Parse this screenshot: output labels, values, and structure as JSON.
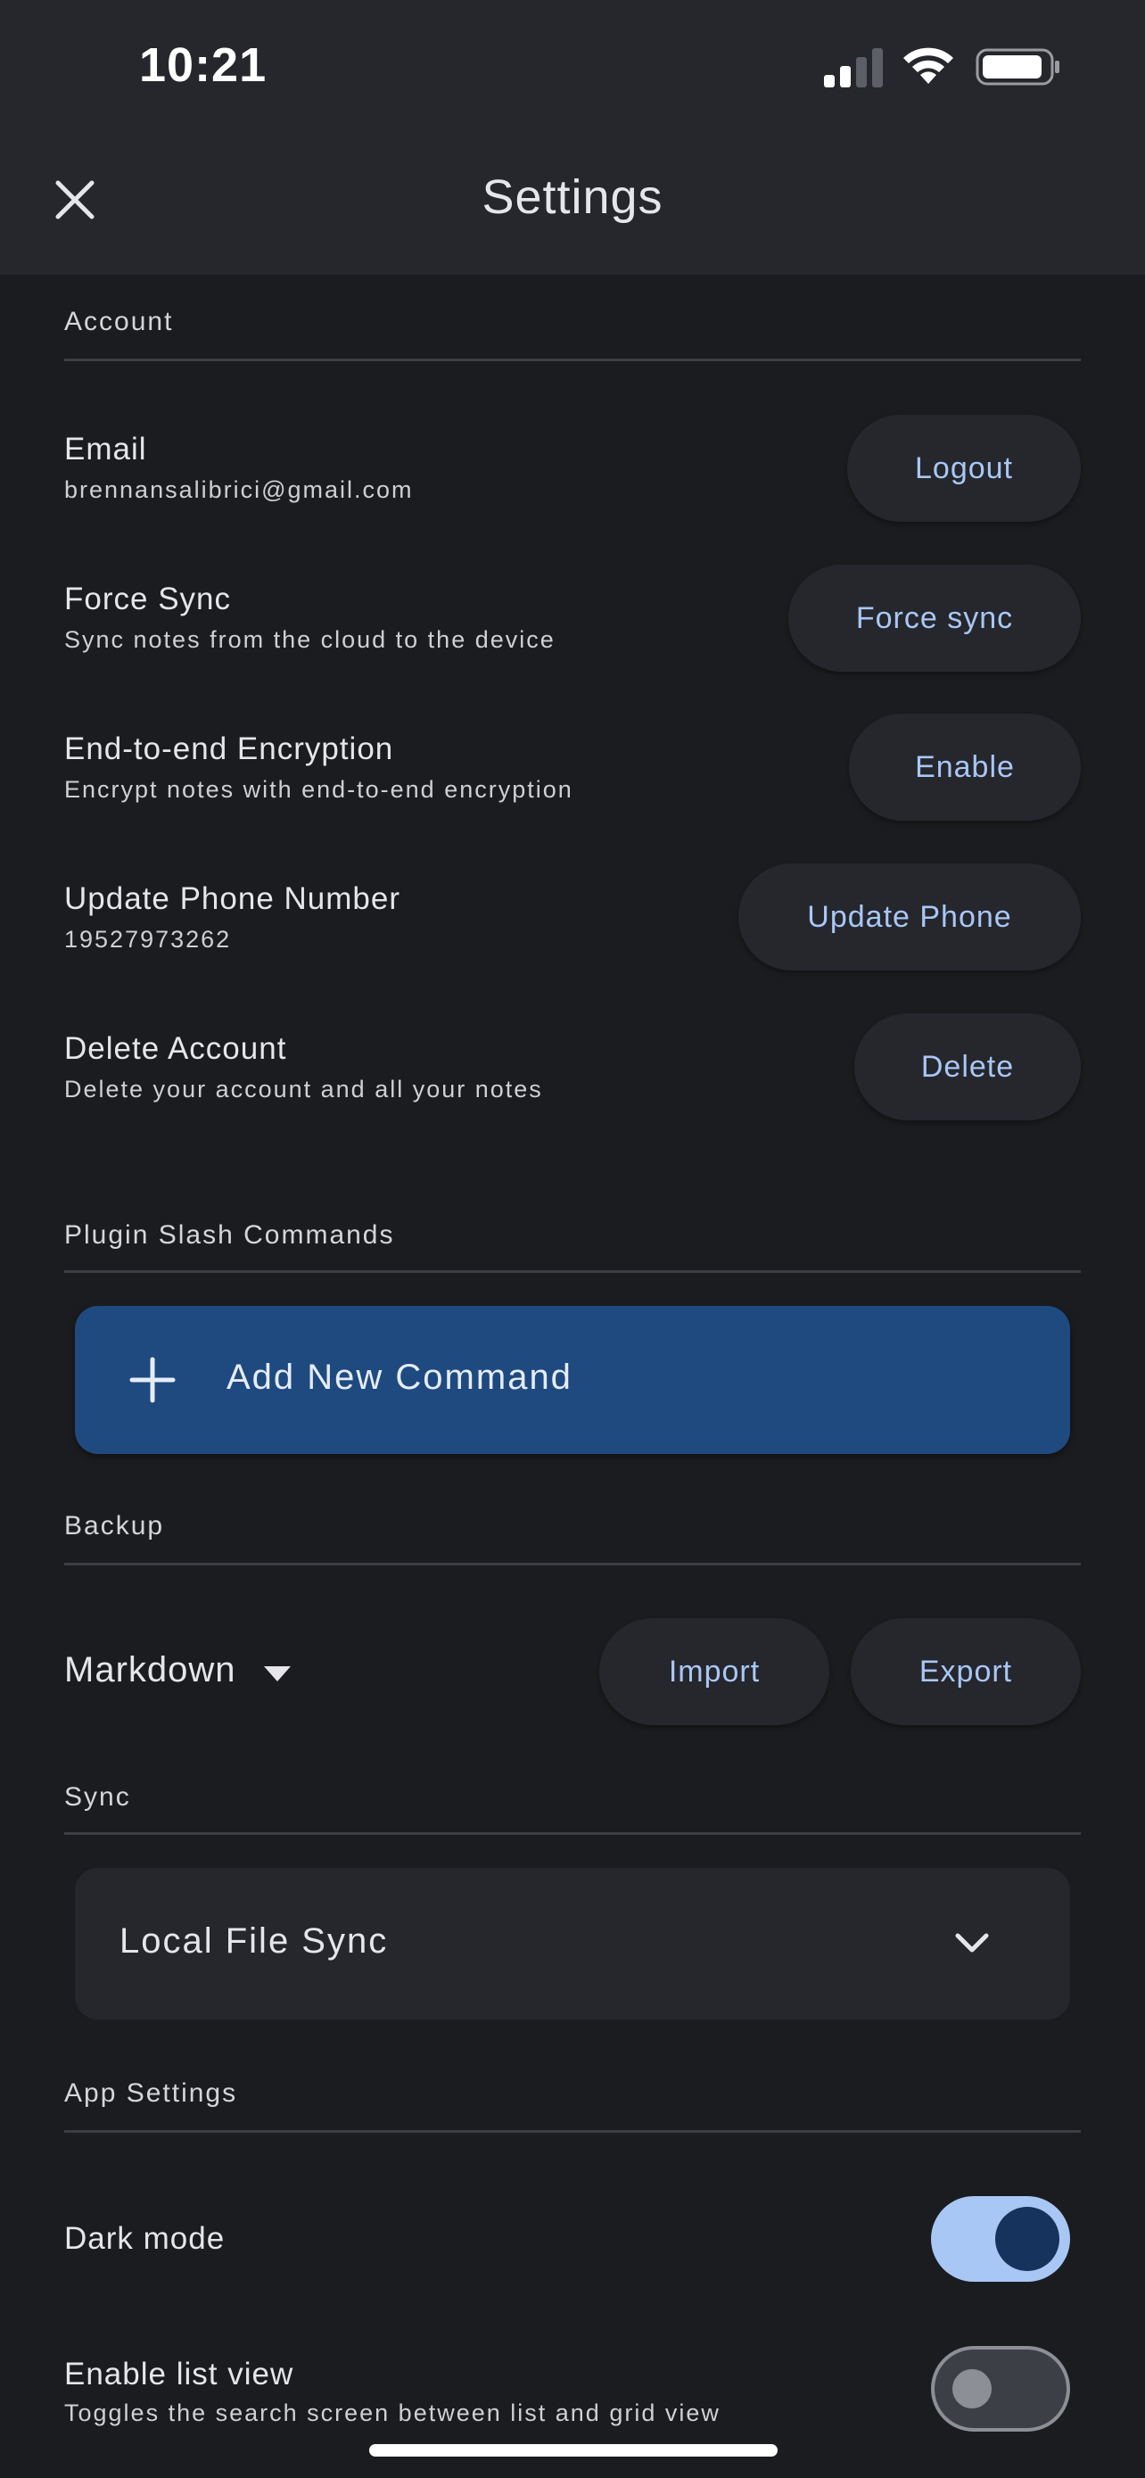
{
  "status_bar": {
    "time": "10:21"
  },
  "header": {
    "title": "Settings"
  },
  "account": {
    "section_label": "Account",
    "rows": [
      {
        "title": "Email",
        "subtitle": "brennansalibrici@gmail.com",
        "button": "Logout"
      },
      {
        "title": "Force Sync",
        "subtitle": "Sync notes from the cloud to the device",
        "button": "Force sync"
      },
      {
        "title": "End-to-end Encryption",
        "subtitle": "Encrypt notes with end-to-end encryption",
        "button": "Enable"
      },
      {
        "title": "Update Phone Number",
        "subtitle": "19527973262",
        "button": "Update Phone"
      },
      {
        "title": "Delete Account",
        "subtitle": "Delete your account and all your notes",
        "button": "Delete"
      }
    ]
  },
  "plugins": {
    "section_label": "Plugin Slash Commands",
    "add_button": "Add New Command"
  },
  "backup": {
    "section_label": "Backup",
    "format": "Markdown",
    "import_label": "Import",
    "export_label": "Export"
  },
  "sync": {
    "section_label": "Sync",
    "selected": "Local File Sync"
  },
  "app_settings": {
    "section_label": "App Settings",
    "dark_mode": {
      "title": "Dark mode",
      "enabled": true
    },
    "list_view": {
      "title": "Enable list view",
      "subtitle": "Toggles the search screen between list and grid view",
      "enabled": false
    }
  },
  "colors": {
    "background": "#1b1c1f",
    "header": "#25272d",
    "accent_text": "#a9c7f5",
    "primary_button": "#1e4a80",
    "toggle_on_track": "#a9c7f5",
    "toggle_on_knob": "#15335c",
    "toggle_off_track": "#3d3f46"
  }
}
